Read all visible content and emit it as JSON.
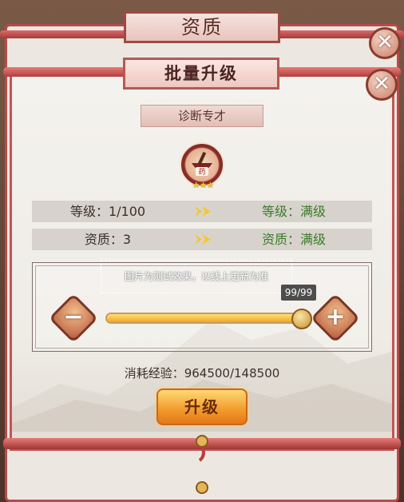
{
  "back_window": {
    "title": "资质"
  },
  "window": {
    "title": "批量升级"
  },
  "skill": {
    "name": "诊断专才",
    "icon_glyph": "药",
    "stars": "★★★"
  },
  "stats": {
    "level": {
      "current": "等级：1/100",
      "target": "等级：满级"
    },
    "quality": {
      "current": "资质：3",
      "target": "资质：满级"
    }
  },
  "slider": {
    "test_note": "图片为测试效果，以线上更新为准",
    "count": "99/99",
    "minus_label": "−",
    "plus_label": "+",
    "fill_fraction": 1.0
  },
  "cost": {
    "text": "消耗经验：964500/148500"
  },
  "upgrade_button": {
    "label": "升级"
  },
  "close_label": "✕",
  "colors": {
    "accent_red": "#c25555",
    "upgrade_orange": "#f19a2c",
    "target_green": "#3c7a2a"
  }
}
